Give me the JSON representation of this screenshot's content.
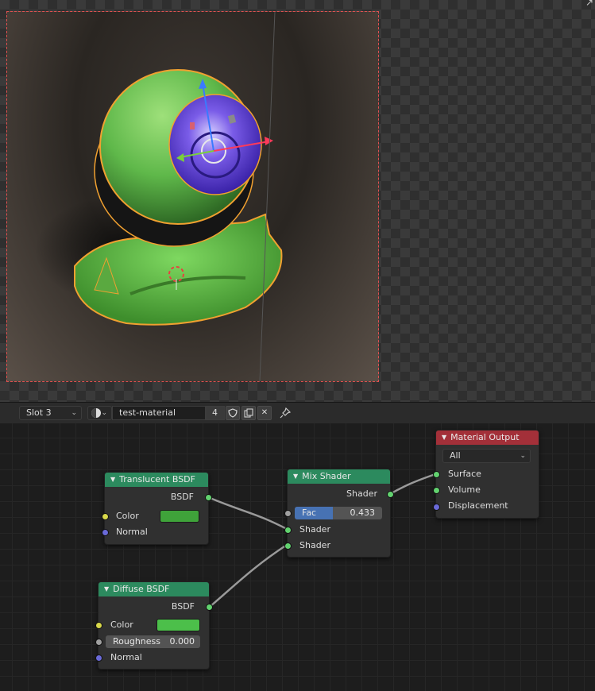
{
  "viewport": {
    "corner_icon": "corner-arrow-icon"
  },
  "header": {
    "slot": "Slot 3",
    "material_name": "test-material",
    "user_count": "4",
    "buttons": [
      "shield-icon",
      "duplicate-icon",
      "close-icon",
      "pin-icon"
    ]
  },
  "nodes": {
    "translucent": {
      "title": "Translucent BSDF",
      "output": "BSDF",
      "color_label": "Color",
      "color": "#3fa33a",
      "normal_label": "Normal"
    },
    "diffuse": {
      "title": "Diffuse BSDF",
      "output": "BSDF",
      "color_label": "Color",
      "color": "#4cbf4a",
      "roughness_label": "Roughness",
      "roughness_value": "0.000",
      "normal_label": "Normal"
    },
    "mix": {
      "title": "Mix Shader",
      "output": "Shader",
      "fac_label": "Fac",
      "fac_value": "0.433",
      "fac_fraction": 0.433,
      "input1": "Shader",
      "input2": "Shader"
    },
    "output": {
      "title": "Material Output",
      "target": "All",
      "surface": "Surface",
      "volume": "Volume",
      "displacement": "Displacement"
    }
  },
  "colors": {
    "node_header_shader": "#2c8a5e",
    "node_header_output": "#a33039",
    "socket_shader": "#62d26f",
    "socket_color": "#d8d84a",
    "socket_vector": "#6a6ad8",
    "selection_outline": "#f0a030"
  }
}
